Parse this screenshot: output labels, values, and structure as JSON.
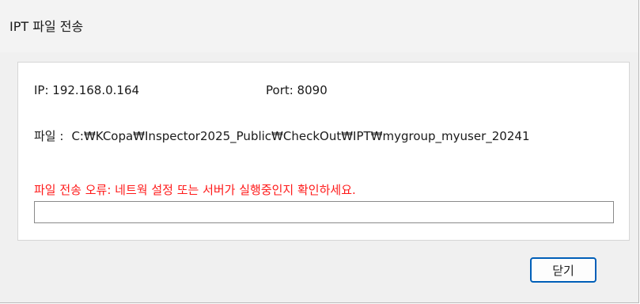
{
  "window": {
    "title": "IPT 파일 전송"
  },
  "connection": {
    "ip_label": "IP: 192.168.0.164",
    "port_label": "Port: 8090"
  },
  "file": {
    "label": "파일 :",
    "path": "C:₩KCopa₩Inspector2025_Public₩CheckOut₩IPT₩mygroup_myuser_20241"
  },
  "status": {
    "error_message": "파일 전송 오류: 네트웍 설정 또는 서버가 실행중인지 확인하세요.",
    "error_color": "#ff1a1a"
  },
  "progress": {
    "value_percent": 0
  },
  "buttons": {
    "close_label": "닫기",
    "accent_color": "#005fb8"
  }
}
